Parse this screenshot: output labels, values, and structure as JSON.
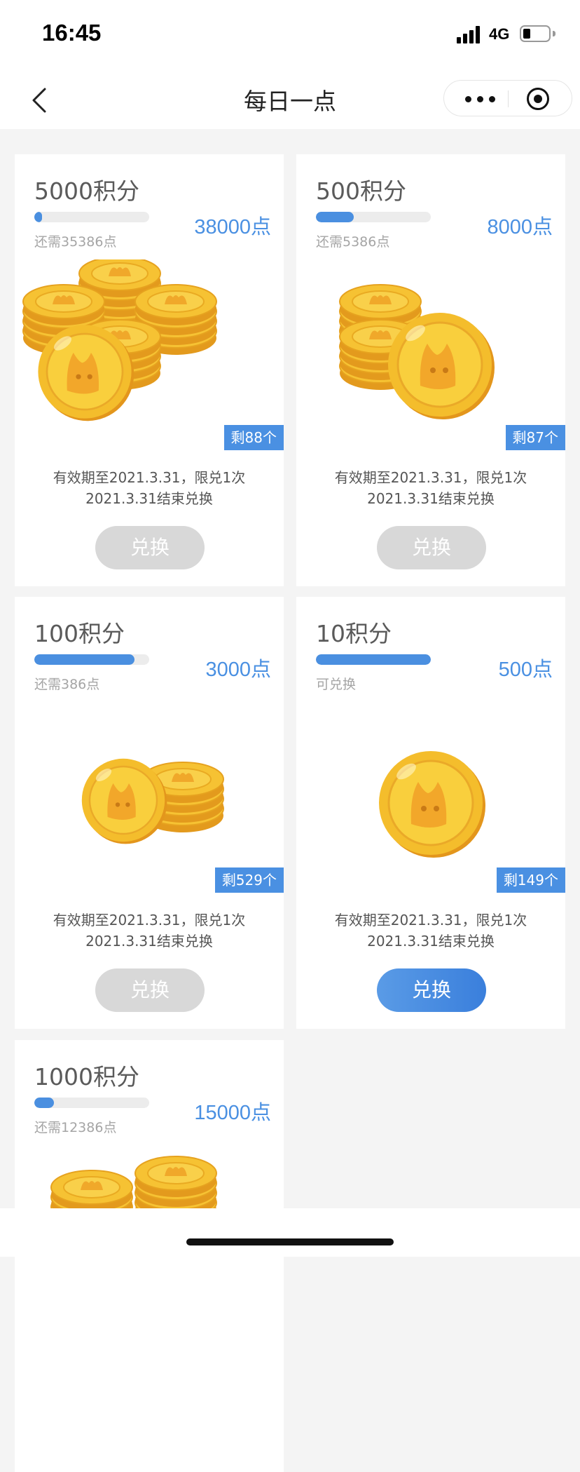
{
  "status_bar": {
    "time": "16:45",
    "network": "4G",
    "battery_level": 0.3,
    "icons": [
      "signal-icon",
      "battery-icon"
    ]
  },
  "nav": {
    "title": "每日一点",
    "back_icon": "chevron-left-icon",
    "capsule_icons": [
      "more-dots-icon",
      "target-close-icon"
    ]
  },
  "colors": {
    "accent": "#4a90e2",
    "disabled_button": "#d8d8d8",
    "coin_gold": "#f3b928"
  },
  "cards": [
    {
      "title": "5000积分",
      "points": "38000点",
      "need": "还需35386点",
      "progress": 0.07,
      "stock": "剩88个",
      "validity_line1": "有效期至2021.3.31，限兑1次",
      "validity_line2": "2021.3.31结束兑换",
      "button": "兑换",
      "enabled": false
    },
    {
      "title": "500积分",
      "points": "8000点",
      "need": "还需5386点",
      "progress": 0.33,
      "stock": "剩87个",
      "validity_line1": "有效期至2021.3.31，限兑1次",
      "validity_line2": "2021.3.31结束兑换",
      "button": "兑换",
      "enabled": false
    },
    {
      "title": "100积分",
      "points": "3000点",
      "need": "还需386点",
      "progress": 0.87,
      "stock": "剩529个",
      "validity_line1": "有效期至2021.3.31，限兑1次",
      "validity_line2": "2021.3.31结束兑换",
      "button": "兑换",
      "enabled": false
    },
    {
      "title": "10积分",
      "points": "500点",
      "need": "可兑换",
      "progress": 1.0,
      "stock": "剩149个",
      "validity_line1": "有效期至2021.3.31，限兑1次",
      "validity_line2": "2021.3.31结束兑换",
      "button": "兑换",
      "enabled": true
    },
    {
      "title": "1000积分",
      "points": "15000点",
      "need": "还需12386点",
      "progress": 0.17
    }
  ]
}
